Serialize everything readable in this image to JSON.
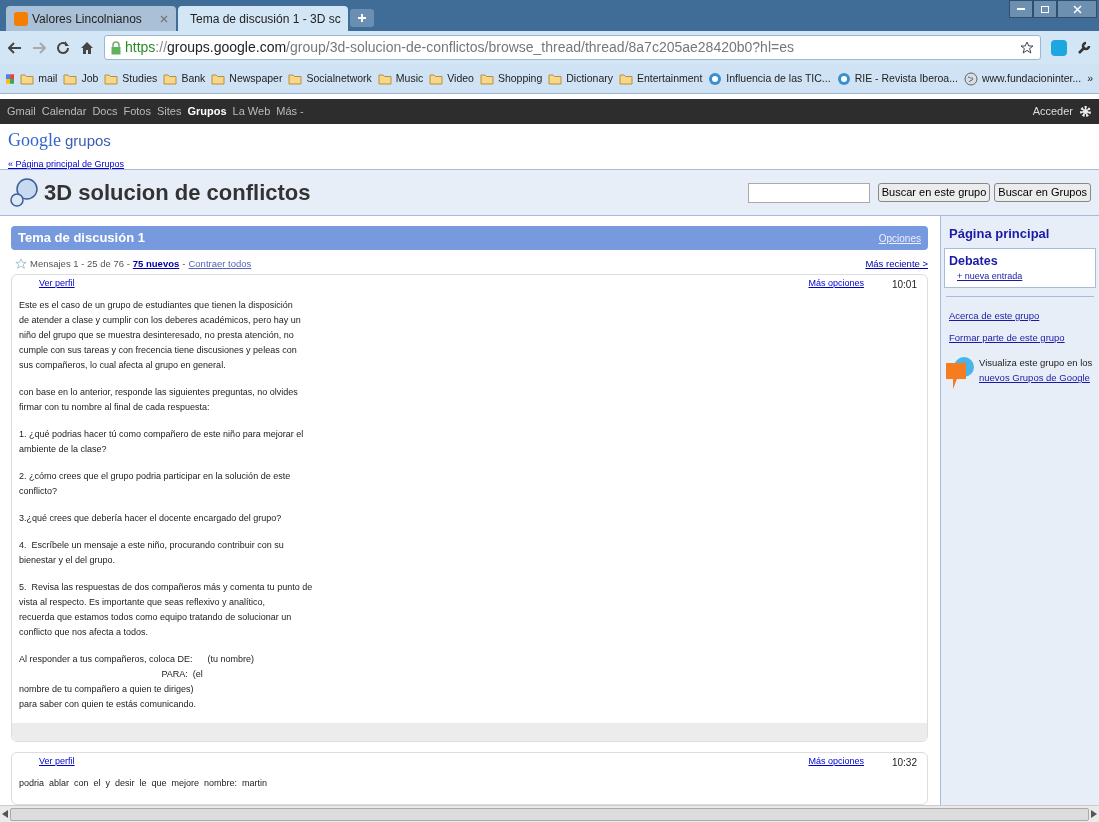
{
  "browser": {
    "tabs": [
      {
        "title": "Valores Lincolnianos",
        "selected": false
      },
      {
        "title": "Tema de discusión 1 - 3D sc",
        "selected": true
      }
    ],
    "address": {
      "scheme": "https",
      "separator": "://",
      "host": "groups.google.com",
      "path": "/group/3d-solucion-de-conflictos/browse_thread/thread/8a7c205ae28420b0?hl=es"
    },
    "bookmarks": [
      {
        "label": "mail",
        "kind": "folder"
      },
      {
        "label": "Job",
        "kind": "folder"
      },
      {
        "label": "Studies",
        "kind": "folder"
      },
      {
        "label": "Bank",
        "kind": "folder"
      },
      {
        "label": "Newspaper",
        "kind": "folder"
      },
      {
        "label": "Socialnetwork",
        "kind": "folder"
      },
      {
        "label": "Music",
        "kind": "folder"
      },
      {
        "label": "Video",
        "kind": "folder"
      },
      {
        "label": "Shopping",
        "kind": "folder"
      },
      {
        "label": "Dictionary",
        "kind": "folder"
      },
      {
        "label": "Entertainment",
        "kind": "folder"
      },
      {
        "label": "Influencia de las TIC...",
        "kind": "site"
      },
      {
        "label": "RIE - Revista Iberoa...",
        "kind": "site"
      },
      {
        "label": "www.fundacioninter...",
        "kind": "globe"
      }
    ],
    "bookmarks_overflow": "»"
  },
  "google_bar": {
    "links": [
      {
        "label": "Gmail",
        "selected": false
      },
      {
        "label": "Calendar",
        "selected": false
      },
      {
        "label": "Docs",
        "selected": false
      },
      {
        "label": "Fotos",
        "selected": false
      },
      {
        "label": "Sites",
        "selected": false
      },
      {
        "label": "Grupos",
        "selected": true
      },
      {
        "label": "La Web",
        "selected": false
      },
      {
        "label": "Más -",
        "selected": false
      }
    ],
    "sign_in": "Acceder"
  },
  "logo": {
    "brand": "Google",
    "product": "grupos"
  },
  "back_link": "« Página principal de Grupos",
  "group": {
    "title": "3D solucion de conflictos",
    "search_buttons": [
      "Buscar en este grupo",
      "Buscar en Grupos"
    ]
  },
  "thread": {
    "title": "Tema de discusión 1",
    "options": "Opciones",
    "summary": "Mensajes 1 - 25 de 76 -",
    "new_count": "75 nuevos",
    "separator": "-",
    "collapse": "Contraer todos",
    "newer": "Más reciente >",
    "messages": [
      {
        "profile": "Ver perfil",
        "more": "Más opciones",
        "time": "10:01",
        "paragraphs": [
          [
            "Este es el caso de un grupo de estudiantes que tienen la disposición",
            "de atender a clase y cumplir con los deberes académicos, pero hay un",
            "niño del grupo que se muestra desinteresado, no presta atención, no",
            "cumple con sus tareas y con frecencia tiene discusiones y peleas con",
            "sus compañeros, lo cual afecta al grupo en general."
          ],
          [
            "con base en lo anterior, responde las siguientes preguntas, no olvides",
            "firmar con tu nombre al final de cada respuesta:"
          ],
          [
            "1. ¿qué podrias hacer tú como compañero de este niño para mejorar el",
            "ambiente de la clase?"
          ],
          [
            "2. ¿cómo crees que el grupo podria participar en la solución de este",
            "conflicto?"
          ],
          [
            "3.¿qué crees que debería hacer el docente encargado del grupo?"
          ],
          [
            "4.  Escríbele un mensaje a este niño, procurando contribuir con su",
            "bienestar y el del grupo."
          ],
          [
            "5.  Revisa las respuestas de dos compañeros más y comenta tu punto de",
            "vista al respecto. Es importante que seas reflexivo y analítico,",
            "recuerda que estamos todos como equipo tratando de solucionar un",
            "conflicto que nos afecta a todos."
          ],
          [
            "Al responder a tus compañeros, coloca DE:      (tu nombre)",
            "                                                         PARA:  (el",
            "nombre de tu compañero a quien te diriges)",
            "para saber con quien te estás comunicando."
          ]
        ]
      },
      {
        "profile": "Ver perfil",
        "more": "Más opciones",
        "time": "10:32",
        "paragraphs": [
          [
            "podria  ablar  con  el  y  desir  le  que  mejore  nombre:  martin"
          ]
        ]
      }
    ]
  },
  "sidebar": {
    "home": "Página principal",
    "section": "Debates",
    "new_post": "+ nueva entrada",
    "links": [
      "Acerca de este grupo",
      "Formar parte de este grupo"
    ],
    "promo_text": "Visualiza este grupo en los",
    "promo_link": "nuevos Grupos de Google"
  }
}
